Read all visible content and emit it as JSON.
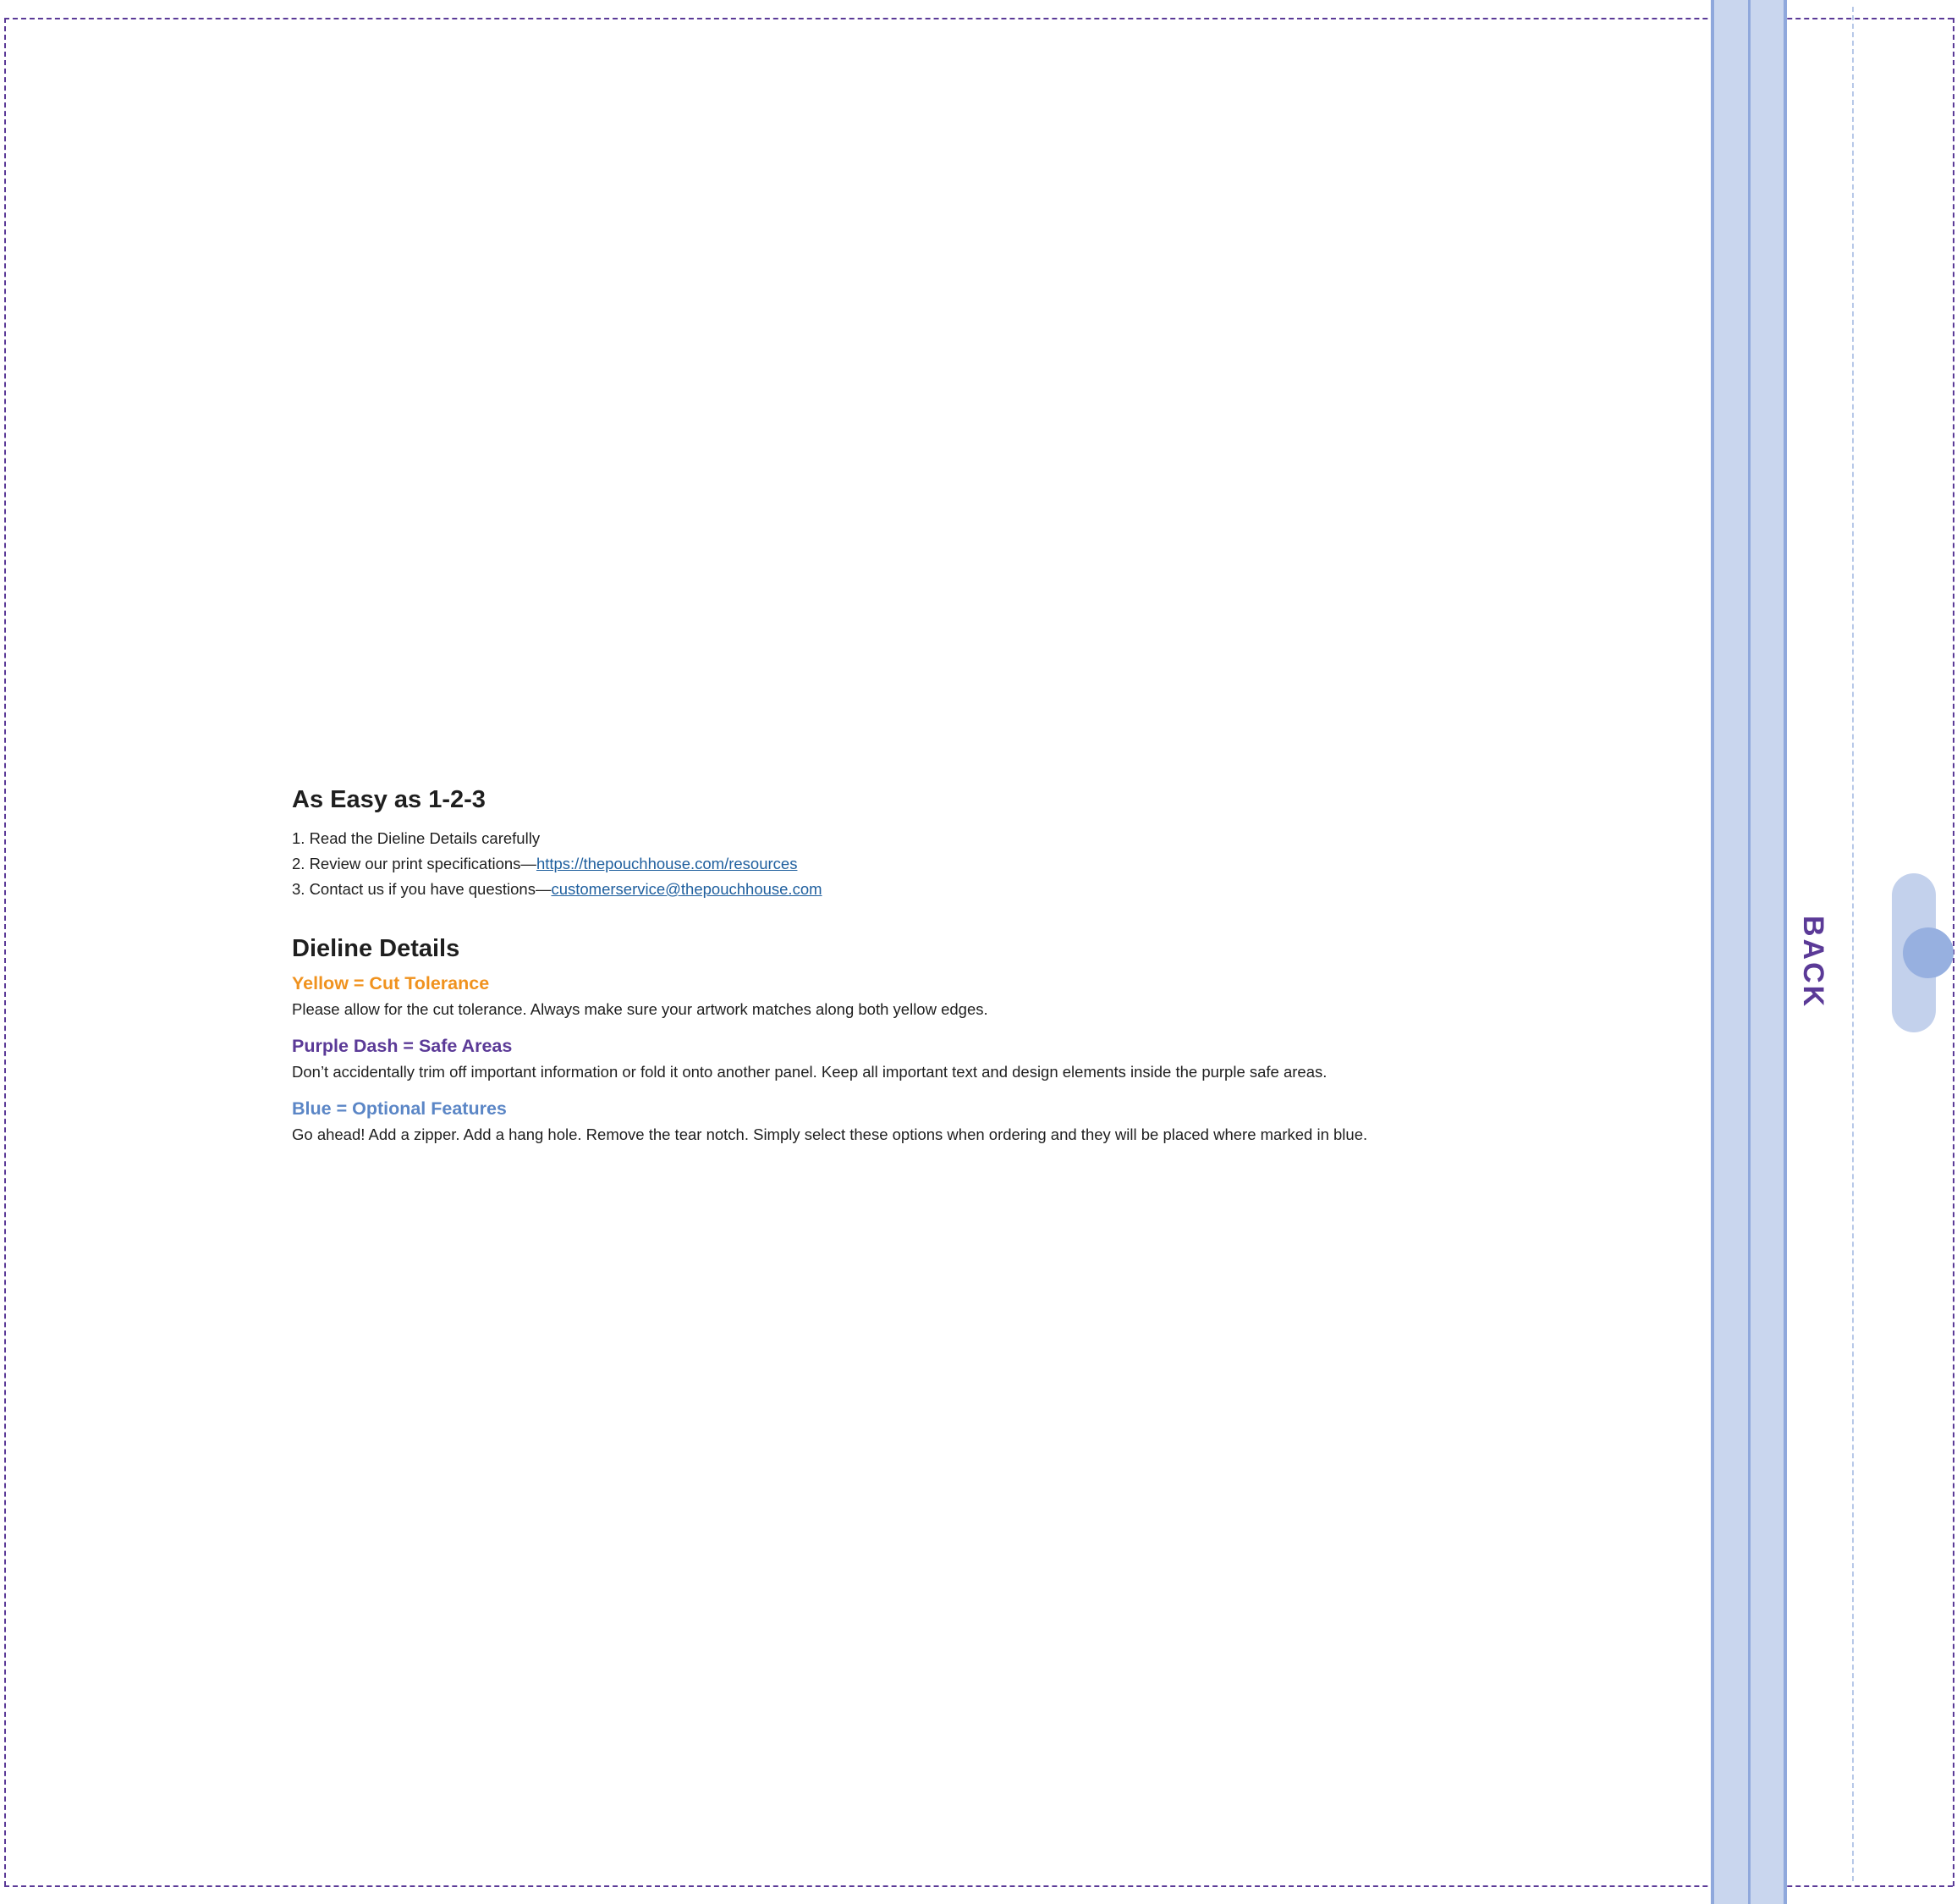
{
  "colors": {
    "yellow_title": "#f0921e",
    "purple_title": "#5b3a97",
    "blue_title": "#5b86c6",
    "safe_line": "#5b3a97",
    "zipper_band": "#c9d6ee",
    "link": "#1f5f9e"
  },
  "side_panel": {
    "back_label": "BACK"
  },
  "intro": {
    "heading": "As Easy as 1-2-3",
    "steps": [
      {
        "text": "1. Read the Dieline Details carefully",
        "link": ""
      },
      {
        "text": "2. Review our print specifications—",
        "link": "https://thepouchhouse.com/resources "
      },
      {
        "text": "3. Contact us if you have questions—",
        "link": "customerservice@thepouchhouse.com"
      }
    ]
  },
  "details": {
    "heading": "Dieline Details",
    "items": [
      {
        "title": "Yellow = Cut Tolerance",
        "description": "Please allow for the cut tolerance. Always make sure your artwork matches along both yellow edges."
      },
      {
        "title": "Purple Dash = Safe Areas",
        "description": "Don’t accidentally trim off important information or fold it onto another panel. Keep all important text and design elements inside the purple safe areas."
      },
      {
        "title": "Blue = Optional Features",
        "description": "Go ahead! Add a zipper. Add a hang hole. Remove the tear notch. Simply select these options when ordering and they will be placed where marked in blue."
      }
    ]
  }
}
